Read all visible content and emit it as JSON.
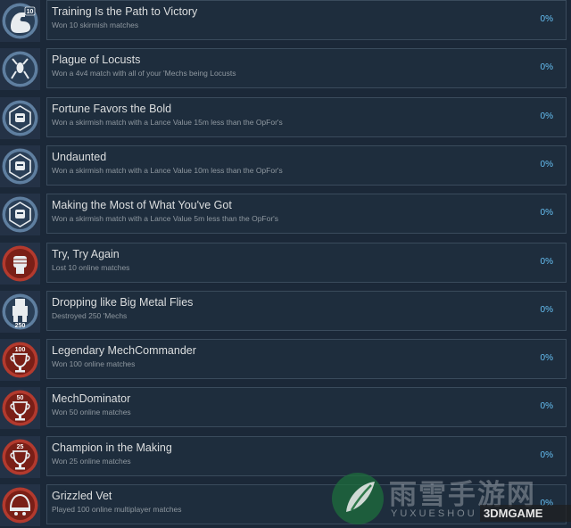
{
  "achievements": [
    {
      "title": "Training Is the Path to Victory",
      "desc": "Won 10 skirmish matches",
      "percent": "0%",
      "icon": "flexed-arm-10-icon",
      "theme": "blue",
      "badge": "10"
    },
    {
      "title": "Plague of Locusts",
      "desc": "Won a 4v4 match with all of your 'Mechs being Locusts",
      "percent": "0%",
      "icon": "locust-mech-icon",
      "theme": "blue",
      "badge": ""
    },
    {
      "title": "Fortune Favors the Bold",
      "desc": "Won a skirmish match with a Lance Value 15m less than the OpFor's",
      "percent": "0%",
      "icon": "mech-head-badge-icon",
      "theme": "blue",
      "badge": ""
    },
    {
      "title": "Undaunted",
      "desc": "Won a skirmish match with a Lance Value 10m less than the OpFor's",
      "percent": "0%",
      "icon": "mech-head-badge-icon",
      "theme": "blue",
      "badge": ""
    },
    {
      "title": "Making the Most of What You've Got",
      "desc": "Won a skirmish match with a Lance Value 5m less than the OpFor's",
      "percent": "0%",
      "icon": "mech-head-badge-icon",
      "theme": "blue",
      "badge": ""
    },
    {
      "title": "Try, Try Again",
      "desc": "Lost 10 online matches",
      "percent": "0%",
      "icon": "fist-icon",
      "theme": "red",
      "badge": ""
    },
    {
      "title": "Dropping like Big Metal Flies",
      "desc": "Destroyed 250 'Mechs",
      "percent": "0%",
      "icon": "mech-250-icon",
      "theme": "blue",
      "badge": "250"
    },
    {
      "title": "Legendary MechCommander",
      "desc": "Won 100 online matches",
      "percent": "0%",
      "icon": "trophy-100-icon",
      "theme": "red",
      "badge": "100"
    },
    {
      "title": "MechDominator",
      "desc": "Won 50 online matches",
      "percent": "0%",
      "icon": "trophy-50-icon",
      "theme": "red",
      "badge": "50"
    },
    {
      "title": "Champion in the Making",
      "desc": "Won 25 online matches",
      "percent": "0%",
      "icon": "trophy-25-icon",
      "theme": "red",
      "badge": "25"
    },
    {
      "title": "Grizzled Vet",
      "desc": "Played 100 online multiplayer matches",
      "percent": "0%",
      "icon": "veteran-helmet-icon",
      "theme": "red",
      "badge": ""
    }
  ],
  "watermark": {
    "cn": "雨雪手游网",
    "en": "YUXUESHOU",
    "brand": "3DMGAME"
  },
  "colors": {
    "background": "#1b2838",
    "card": "#1e2d3d",
    "title": "#dcdedf",
    "desc": "#8f98a0",
    "percent": "#66c0f4",
    "blue_badge": "#5f7fa0",
    "red_badge": "#b33a2e"
  }
}
